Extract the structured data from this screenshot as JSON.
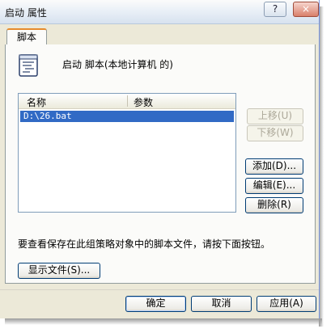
{
  "window": {
    "title": "启动 属性",
    "help_glyph": "?",
    "close_glyph": "×"
  },
  "tabs": [
    {
      "label": "脚本",
      "active": true
    }
  ],
  "panel": {
    "icon": "script-icon",
    "heading": "启动 脚本(本地计算机 的)",
    "list": {
      "columns": [
        "名称",
        "参数"
      ],
      "rows": [
        {
          "name": "D:\\26.bat",
          "params": "",
          "selected": true
        }
      ]
    },
    "buttons": {
      "up": "上移(U)",
      "down": "下移(W)",
      "add": "添加(D)...",
      "edit": "编辑(E)...",
      "remove": "删除(R)"
    },
    "note": "要查看保存在此组策略对象中的脚本文件，请按下面按钮。",
    "show_files": "显示文件(S)..."
  },
  "footer": {
    "ok": "确定",
    "cancel": "取消",
    "apply": "应用(A)"
  },
  "colors": {
    "selection": "#316ac5",
    "dialog_bg": "#ece9d8",
    "panel_bg": "#fbfbf9",
    "tab_highlight": "#e68b2c"
  }
}
